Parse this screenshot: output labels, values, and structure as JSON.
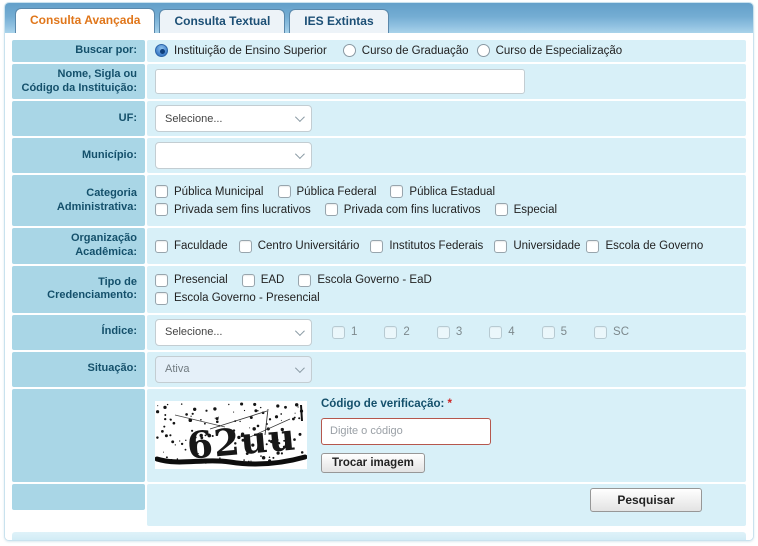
{
  "tabs": {
    "avancada": "Consulta Avançada",
    "textual": "Consulta Textual",
    "extintas": "IES Extintas"
  },
  "form": {
    "buscar": {
      "label": "Buscar por:",
      "opt1": "Instituição de Ensino Superior",
      "opt2": "Curso de Graduação",
      "opt3": "Curso de Especialização",
      "selected": "Instituição de Ensino Superior"
    },
    "nome": {
      "label": "Nome, Sigla ou Código da Instituição:",
      "value": ""
    },
    "uf": {
      "label": "UF:",
      "value": "Selecione..."
    },
    "municipio": {
      "label": "Município:",
      "value": ""
    },
    "categoria": {
      "label": "Categoria Administrativa:",
      "row1": [
        "Pública Municipal",
        "Pública Federal",
        "Pública Estadual"
      ],
      "row2": [
        "Privada sem fins lucrativos",
        "Privada com fins lucrativos",
        "Especial"
      ]
    },
    "organizacao": {
      "label": "Organização Acadêmica:",
      "options": [
        "Faculdade",
        "Centro Universitário",
        "Institutos Federais",
        "Universidade",
        "Escola de Governo"
      ]
    },
    "credenciamento": {
      "label": "Tipo de Credenciamento:",
      "row1": [
        "Presencial",
        "EAD",
        "Escola Governo - EaD"
      ],
      "row2": [
        "Escola Governo - Presencial"
      ]
    },
    "indice": {
      "label": "Índice:",
      "value": "Selecione...",
      "checks": [
        "1",
        "2",
        "3",
        "4",
        "5",
        "SC"
      ]
    },
    "situacao": {
      "label": "Situação:",
      "value": "Ativa"
    },
    "captcha": {
      "code": "62uu",
      "label": "Código de verificação:",
      "required": "*",
      "placeholder": "Digite o código",
      "trocar": "Trocar imagem"
    },
    "pesquisar": "Pesquisar"
  },
  "colors": {
    "tab_active_text": "#e0761a",
    "tab_inactive_text": "#1c4f75",
    "label_cell_bg": "#a9d6e6",
    "content_cell_bg": "#d8f0f8",
    "label_text": "#14506b",
    "captcha_input_border": "#b5574d",
    "required_mark": "#cc2222"
  }
}
